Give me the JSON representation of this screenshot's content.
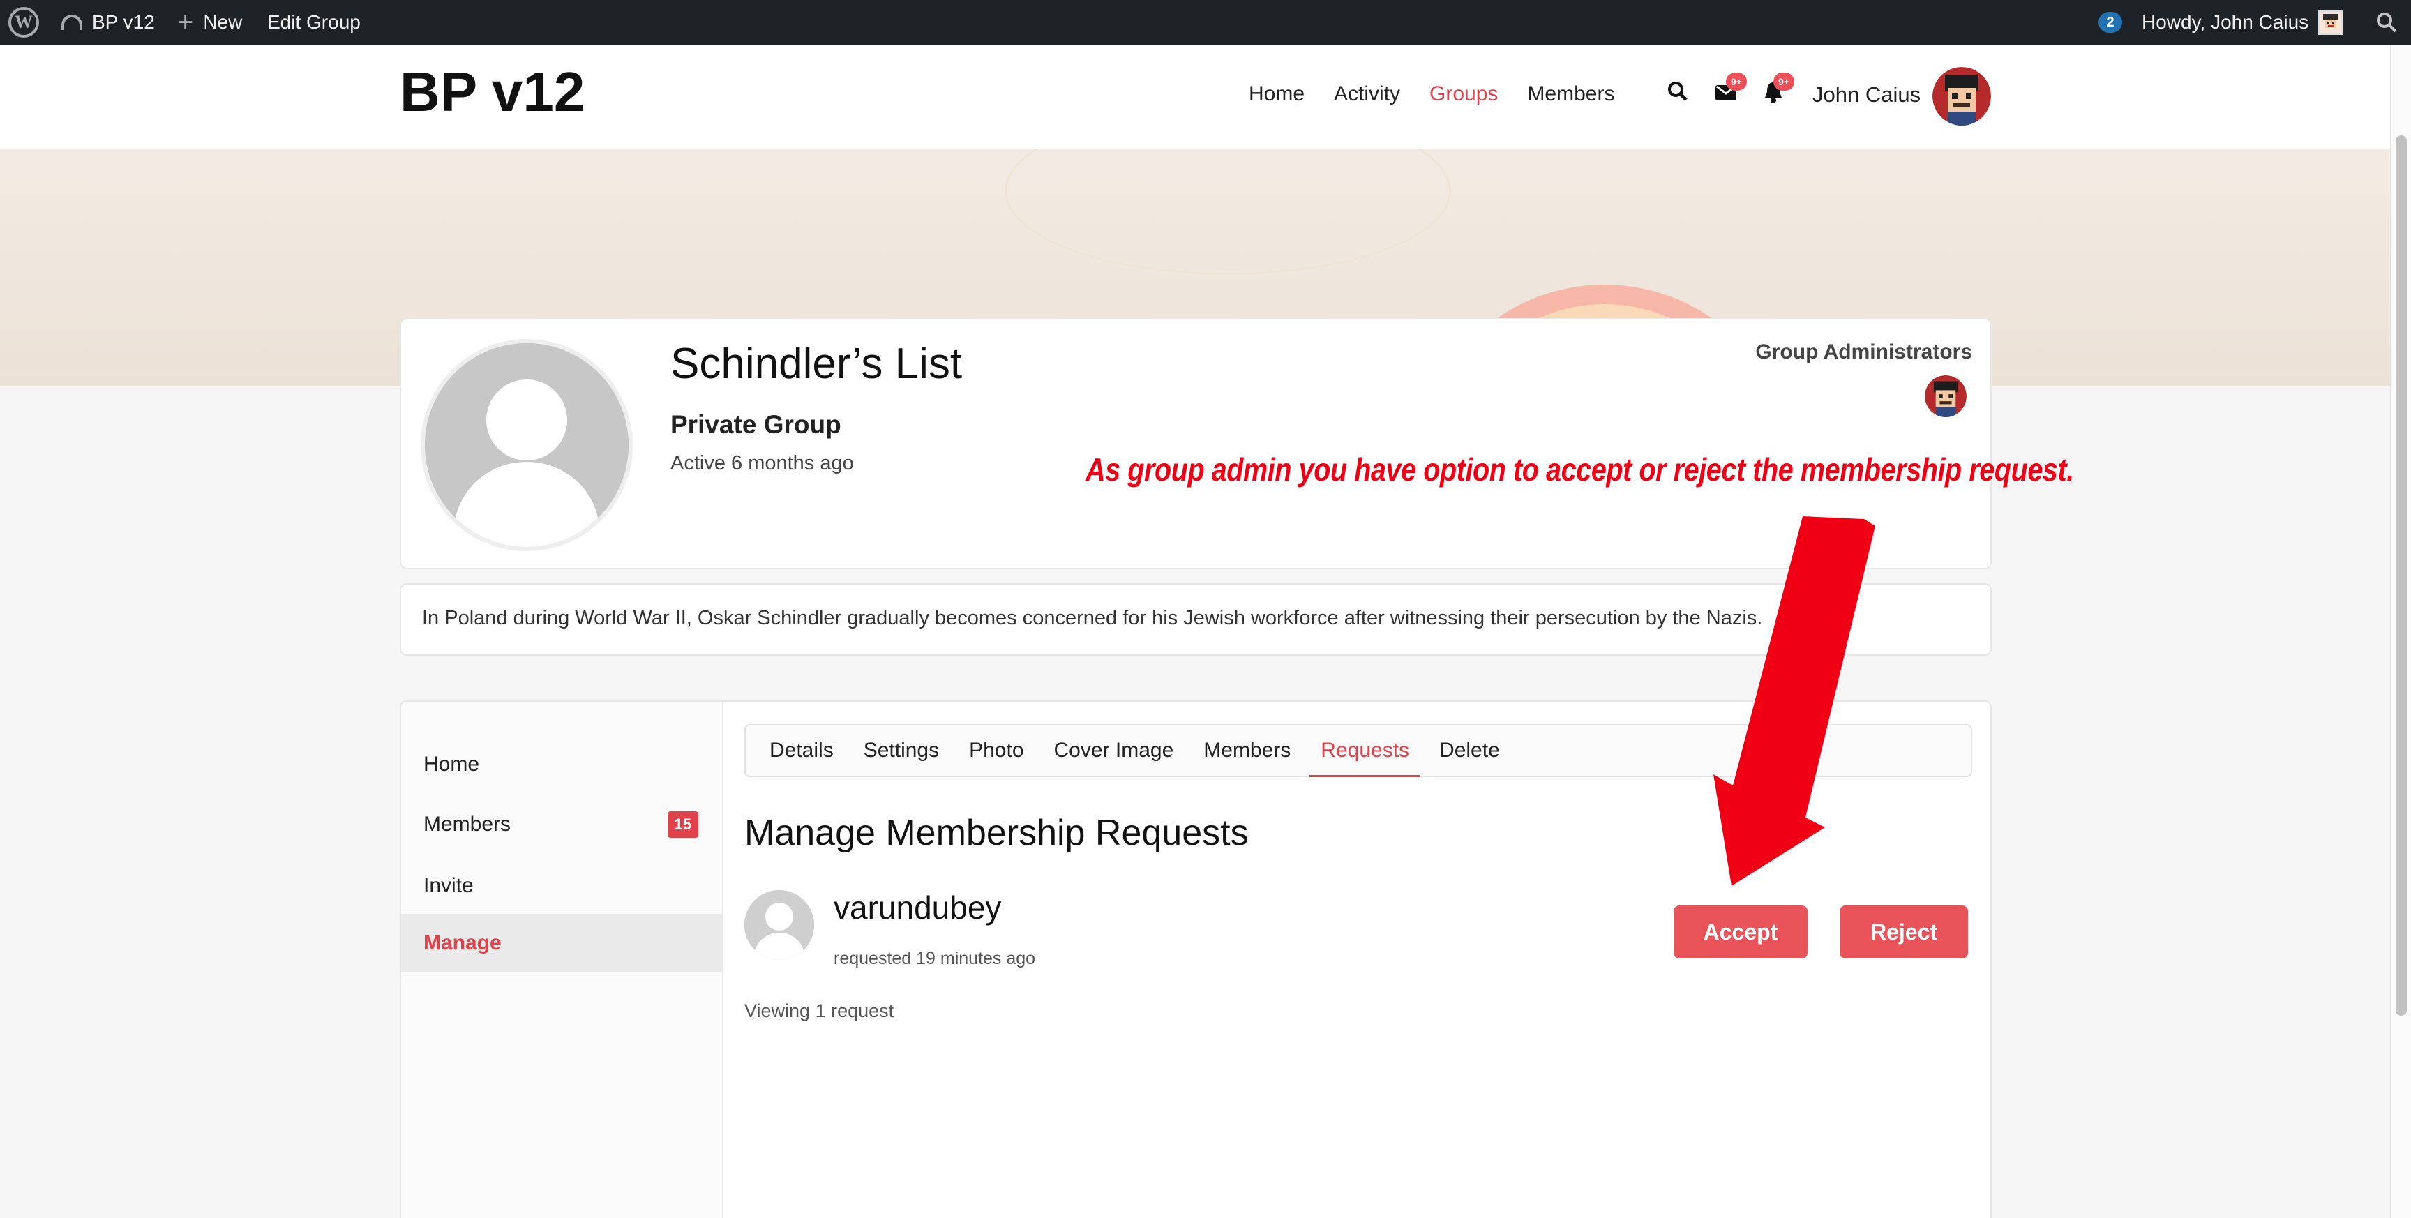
{
  "admin_bar": {
    "wp_logo_icon": "wordpress-logo-icon",
    "site_name": "BP v12",
    "new_label": "New",
    "edit_label": "Edit Group",
    "count": "2",
    "howdy": "Howdy, John Caius"
  },
  "header": {
    "site_title": "BP v12",
    "nav": [
      "Home",
      "Activity",
      "Groups",
      "Members"
    ],
    "current_nav": "Groups",
    "messages_badge": "9+",
    "notifications_badge": "9+",
    "user_name": "John Caius"
  },
  "group": {
    "title": "Schindler’s List",
    "type": "Private Group",
    "active": "Active 6 months ago",
    "admins_label": "Group Administrators",
    "description": "In Poland during World War II, Oskar Schindler gradually becomes concerned for his Jewish workforce after witnessing their persecution by the Nazis."
  },
  "sidebar": {
    "items": [
      {
        "label": "Home"
      },
      {
        "label": "Members",
        "count": "15"
      },
      {
        "label": "Invite"
      },
      {
        "label": "Manage",
        "active": true
      }
    ]
  },
  "subnav": {
    "items": [
      "Details",
      "Settings",
      "Photo",
      "Cover Image",
      "Members",
      "Requests",
      "Delete"
    ],
    "current": "Requests"
  },
  "requests": {
    "heading": "Manage Membership Requests",
    "items": [
      {
        "name": "varundubey",
        "time": "requested 19 minutes ago"
      }
    ],
    "accept_label": "Accept",
    "reject_label": "Reject",
    "viewing": "Viewing 1 request"
  },
  "annotation": {
    "text": "As group admin you have option to accept or reject the membership request."
  },
  "colors": {
    "accent": "#e0414a",
    "button": "#e9535a",
    "admin_bar": "#1d2327",
    "annotation": "#f00014"
  }
}
